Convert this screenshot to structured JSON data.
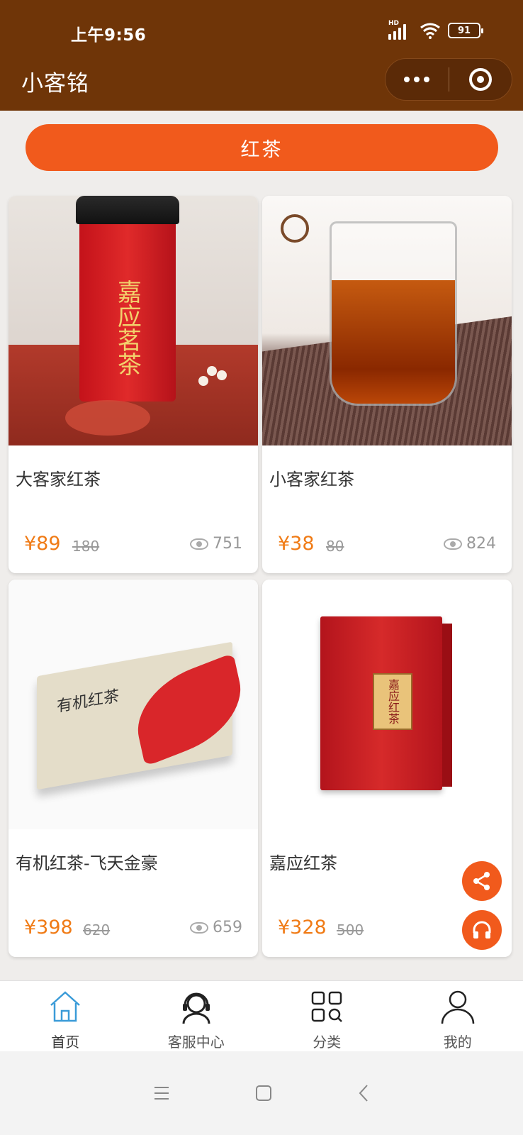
{
  "status_bar": {
    "time": "上午9:56",
    "network": "HD",
    "battery": "91"
  },
  "header": {
    "title": "小客铭"
  },
  "category": {
    "label": "红茶"
  },
  "products": [
    {
      "name": "大客家红茶",
      "price": "¥89",
      "original_price": "180",
      "views": "751"
    },
    {
      "name": "小客家红茶",
      "price": "¥38",
      "original_price": "80",
      "views": "824"
    },
    {
      "name": "有机红茶-飞天金豪",
      "price": "¥398",
      "original_price": "620",
      "views": "659"
    },
    {
      "name": "嘉应红茶",
      "price": "¥328",
      "original_price": "500",
      "views": ""
    }
  ],
  "image_text": {
    "tin": "嘉应茗茶",
    "box3": "有机红茶",
    "box4": "嘉应红茶"
  },
  "tabbar": {
    "items": [
      {
        "label": "首页",
        "icon": "home-icon"
      },
      {
        "label": "客服中心",
        "icon": "headset-icon"
      },
      {
        "label": "分类",
        "icon": "grid-search-icon"
      },
      {
        "label": "我的",
        "icon": "user-icon"
      }
    ]
  },
  "colors": {
    "header_bg": "#6f3508",
    "accent": "#f15a1c",
    "price": "#f07b16",
    "home_active": "#3a9bd8"
  }
}
